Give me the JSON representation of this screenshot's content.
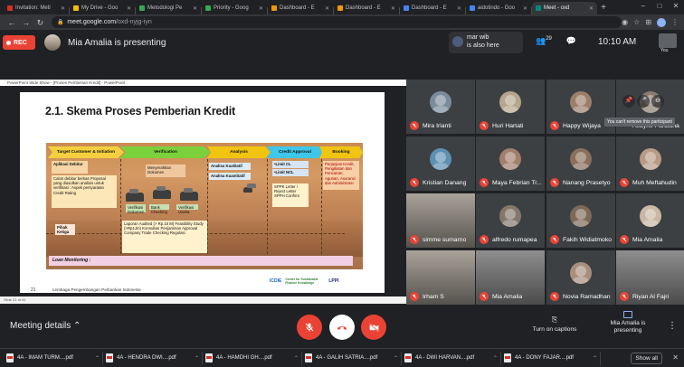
{
  "browser": {
    "tabs": [
      {
        "label": "Invitation: Meti",
        "color": "#d93025"
      },
      {
        "label": "My Drive - Goo",
        "color": "#fbbc04"
      },
      {
        "label": "Metodologi Pe",
        "color": "#34a853"
      },
      {
        "label": "Priority - Goog",
        "color": "#34a853"
      },
      {
        "label": "Dashboard - E",
        "color": "#f29900"
      },
      {
        "label": "Dashboard - E",
        "color": "#f29900"
      },
      {
        "label": "Dashboard - E",
        "color": "#4285f4"
      },
      {
        "label": "aidotindo - Goo",
        "color": "#4285f4"
      },
      {
        "label": "Meet - oxd",
        "color": "#00897b"
      }
    ],
    "url_host": "meet.google.com",
    "url_path": "/oxd-nyjg-iyn"
  },
  "meet_top": {
    "rec_label": "REC",
    "presenting_text": "Mia Amalia is presenting",
    "chat_popup": {
      "line1": "mar wib",
      "line2": "is also here"
    },
    "participants_count": "29",
    "clock": "10:10 AM",
    "you_label": "You"
  },
  "slide": {
    "window_title": "PowerPoint Slide Show - [Proses Pemberian Kredit] - PowerPoint",
    "title": "2.1. Skema Proses Pemberian Kredit",
    "page_number": "21",
    "footer": "Lembaga Pengembangan Perbankan Indonesia",
    "status_text": "Slide 21 of 41",
    "logos": [
      "ICDIE",
      "Center for Sustainable Finance Knowledge",
      "LPPI"
    ],
    "stages": [
      {
        "label": "Target Customer & Initiation",
        "color": "#f4d03f"
      },
      {
        "label": "Verification",
        "color": "#7bd13c"
      },
      {
        "label": "Analysis",
        "color": "#f1c40f"
      },
      {
        "label": "Credit Approval",
        "color": "#3ec7e8"
      },
      {
        "label": "Booking",
        "color": "#f1c40f"
      }
    ],
    "boxes": {
      "aplikasi": "Aplikasi Debitur",
      "initiation_list": "Calon debitur berkas Proposal yang diusulkan analisis untuk verifikasi : Aspek persyaratan Credit Rating",
      "menyerahkan": "Menyerahkan Dokumen",
      "analisa_kualitatif": "Analisa Kualitatif",
      "analisa_kuantitatif": "Analisa Kuantitatif",
      "limit_cl": "•Limit CL",
      "limit_ncl": "•Limit NCL",
      "sppk": "SPPK Letter / Reject Letter SPPH Confirm",
      "booking_box": "Perjanjian Kredit, Pengikatan dan Pencairan, Agunan, Asuransi dan Administrasi",
      "pihak_ketiga": "Pihak Ketiga",
      "bank_checking": "Bank Checking",
      "verifikasi_usaha": "Verifikasi Usaha",
      "verifikasi_dokumen": "Verifikasi Dokumen",
      "laporan_list": "Laporan Audited (> Rp.10 M) Feasibility Study (>Rp1Jm) Konsultan Penjaminan Approval Company Trade Checking Regulasi",
      "loan_monitoring": "Loan Monitoring :"
    }
  },
  "participants": [
    {
      "name": "Mira Irianti",
      "color": "#7a8c9b",
      "video": false
    },
    {
      "name": "Huri Hartati",
      "color": "#b5a68c",
      "video": false
    },
    {
      "name": "Happy Wijaya",
      "color": "#9c7e6a",
      "video": false
    },
    {
      "name": "Kristian Danang",
      "color": "#5d8fb0",
      "video": false
    },
    {
      "name": "Maya Febrian Tr...",
      "color": "#a17f6b",
      "video": false
    },
    {
      "name": "Nanang Prasetyo",
      "color": "#8a6f5c",
      "video": false
    },
    {
      "name": "Muh Meftahudin",
      "color": "#b89b84",
      "video": false
    },
    {
      "name": "simme sumarno",
      "color": "#6b6b6b",
      "video": true
    },
    {
      "name": "alfredo rumapea",
      "color": "#85786a",
      "video": false
    },
    {
      "name": "Fakih Widiatmoko",
      "color": "#7d6958",
      "video": false
    },
    {
      "name": "Mia Amalia",
      "color": "#c9b8a4",
      "video": false
    },
    {
      "name": "Irham S",
      "color": "#5a5a5a",
      "video": true
    },
    {
      "name": "Mia Amalia",
      "color": "#8a8a8a",
      "video": true
    },
    {
      "name": "Novia Ramadhan",
      "color": "#a88f7d",
      "video": false
    },
    {
      "name": "Riyan Al Fajri",
      "color": "#777",
      "video": true
    }
  ],
  "partial_tile_name": "Alfayhe Pardiana",
  "tooltip": "You can't remove this participant",
  "bottom": {
    "meeting_details": "Meeting details",
    "captions_label": "Turn on captions",
    "presenting_label": "Mia Amalia is presenting"
  },
  "downloads": [
    "4A - IMAM TURM....pdf",
    "4A - HENDRA DWI....pdf",
    "4A - HAMDHI GH....pdf",
    "4A - GALIH SATRIA....pdf",
    "4A - DWI HARVAN....pdf",
    "4A - DONY FAJAR....pdf"
  ],
  "show_all": "Show all"
}
